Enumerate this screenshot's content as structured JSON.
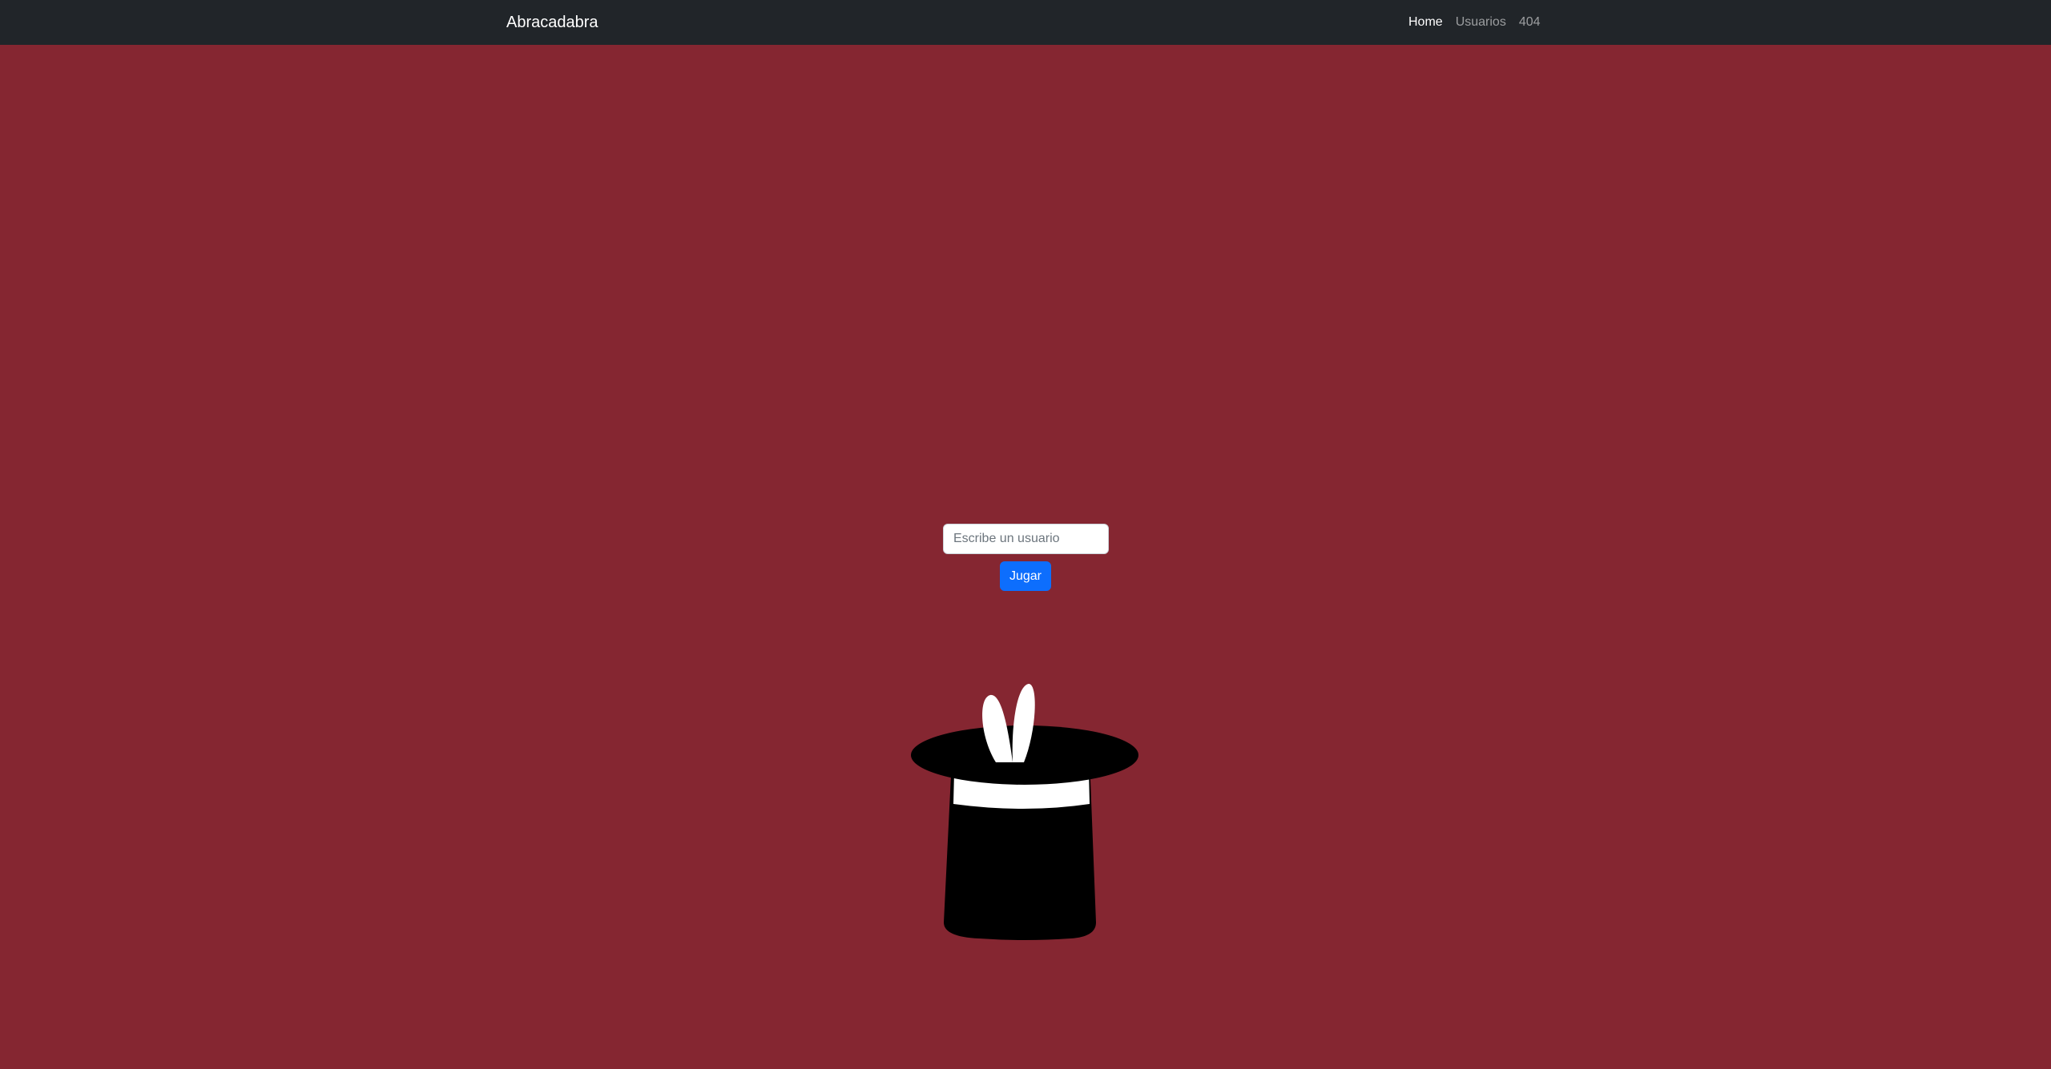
{
  "navbar": {
    "brand": "Abracadabra",
    "links": [
      {
        "label": "Home",
        "active": true
      },
      {
        "label": "Usuarios",
        "active": false
      },
      {
        "label": "404",
        "active": false
      }
    ]
  },
  "form": {
    "input_placeholder": "Escribe un usuario",
    "input_value": "",
    "button_label": "Jugar"
  },
  "colors": {
    "page_background": "#852631",
    "navbar_background": "#212529",
    "button_primary": "#0d6efd",
    "hat": "#000000",
    "hat_band": "#ffffff",
    "rabbit_ears": "#ffffff"
  },
  "illustration": {
    "icon": "magic-top-hat-with-rabbit-ears-icon"
  }
}
